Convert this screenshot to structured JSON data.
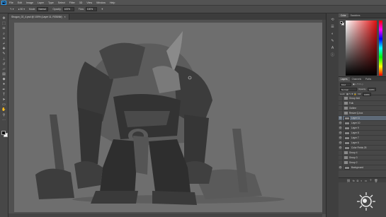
{
  "menubar": {
    "logo": "Ps",
    "items": [
      "File",
      "Edit",
      "Image",
      "Layer",
      "Type",
      "Select",
      "Filter",
      "3D",
      "View",
      "Window",
      "Help"
    ]
  },
  "options": {
    "mode_label": "Mode:",
    "mode_value": "Normal",
    "opacity_label": "Opacity:",
    "opacity_value": "100%",
    "flow_label": "Flow:",
    "flow_value": "100%"
  },
  "document": {
    "tab_title": "Shogun_02_4.psd @ 100% (Layer 11, RGB/8#)"
  },
  "panels": {
    "color_tabs": [
      "Color",
      "Swatches"
    ],
    "layer_tabs": [
      "Layers",
      "Channels",
      "Paths"
    ],
    "kind_label": "Kind",
    "blend_value": "Normal",
    "opacity_label": "Opacity:",
    "opacity_value": "100%",
    "lock_label": "Lock:",
    "fill_label": "Fill:",
    "fill_value": "100%"
  },
  "layers": [
    {
      "name": "Group fold",
      "type": "group",
      "visible": false,
      "selected": false
    },
    {
      "name": "Folk",
      "type": "group",
      "visible": false,
      "selected": false
    },
    {
      "name": "Outline",
      "type": "group",
      "visible": false,
      "selected": false
    },
    {
      "name": "Resize Q-box",
      "type": "group",
      "visible": false,
      "selected": false
    },
    {
      "name": "Layer 11",
      "type": "layer",
      "visible": true,
      "selected": true
    },
    {
      "name": "Layer 10",
      "type": "layer",
      "visible": true,
      "selected": false
    },
    {
      "name": "Layer 9",
      "type": "layer",
      "visible": true,
      "selected": false
    },
    {
      "name": "Layer 8",
      "type": "layer",
      "visible": true,
      "selected": false
    },
    {
      "name": "Layer 7",
      "type": "layer",
      "visible": true,
      "selected": false
    },
    {
      "name": "Layer 6",
      "type": "layer",
      "visible": true,
      "selected": false
    },
    {
      "name": "Color Fields 25",
      "type": "layer",
      "visible": true,
      "selected": false
    },
    {
      "name": "Group 4",
      "type": "group",
      "visible": false,
      "selected": false
    },
    {
      "name": "Group 3",
      "type": "group",
      "visible": false,
      "selected": false
    },
    {
      "name": "Group 2",
      "type": "group",
      "visible": false,
      "selected": false
    },
    {
      "name": "Background",
      "type": "layer",
      "visible": true,
      "selected": false
    }
  ],
  "colors": {
    "ui_bg": "#535353",
    "canvas_bg": "#6e6e6e",
    "selection": "#5e6a78",
    "foreground": "#111111",
    "background": "#ffffff"
  }
}
